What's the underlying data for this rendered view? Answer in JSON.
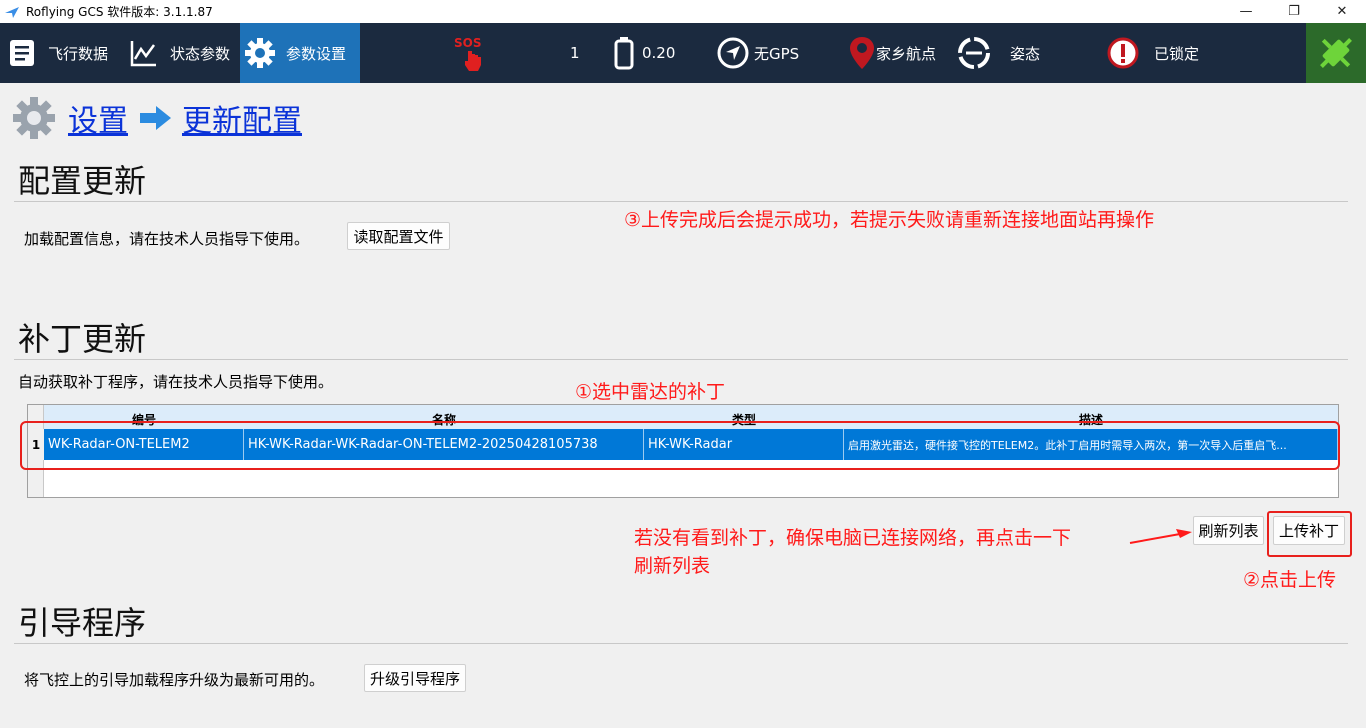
{
  "window": {
    "title": "Roflying GCS 软件版本: 3.1.1.87"
  },
  "toolbar": {
    "flight_data": "飞行数据",
    "status_params": "状态参数",
    "param_settings": "参数设置",
    "sos": "SOS",
    "count": "1",
    "battery": "0.20",
    "gps": "无GPS",
    "home": "家乡航点",
    "attitude": "姿态",
    "locked": "已锁定"
  },
  "breadcrumb": {
    "settings": "设置",
    "update_config": "更新配置"
  },
  "config_update": {
    "title": "配置更新",
    "description": "加载配置信息，请在技术人员指导下使用。",
    "read_button": "读取配置文件"
  },
  "patch_update": {
    "title": "补丁更新",
    "description": "自动获取补丁程序，请在技术人员指导下使用。",
    "columns": [
      "编号",
      "名称",
      "类型",
      "描述"
    ],
    "rows": [
      {
        "index": "1",
        "id": "WK-Radar-ON-TELEM2",
        "name": "HK-WK-Radar-WK-Radar-ON-TELEM2-20250428105738",
        "type": "HK-WK-Radar",
        "desc": "启用激光雷达，硬件接飞控的TELEM2。此补丁启用时需导入两次，第一次导入后重启飞..."
      }
    ],
    "refresh_button": "刷新列表",
    "upload_button": "上传补丁"
  },
  "bootloader": {
    "title": "引导程序",
    "description": "将飞控上的引导加载程序升级为最新可用的。",
    "upgrade_button": "升级引导程序"
  },
  "annotations": {
    "step1": "①选中雷达的补丁",
    "step2": "②点击上传",
    "step3": "③上传完成后会提示成功，若提示失败请重新连接地面站再操作",
    "hint_line1": "若没有看到补丁，确保电脑已连接网络，再点击一下",
    "hint_line2": "刷新列表"
  },
  "colors": {
    "toolbar_bg": "#1b2a3f",
    "active_tab": "#1e72b8",
    "link": "#0b33d8",
    "annotation": "#ff1a1a",
    "row_selected": "#0078d7"
  }
}
